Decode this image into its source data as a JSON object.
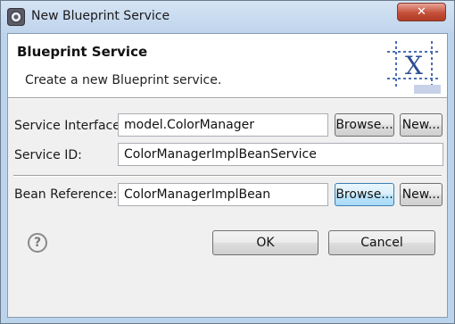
{
  "window": {
    "title": "New Blueprint Service",
    "close_glyph": "✕"
  },
  "header": {
    "title": "Blueprint Service",
    "description": "Create a new Blueprint service.",
    "banner_icon": "blueprint-x-icon"
  },
  "form": {
    "service_interface": {
      "label": "Service Interface:",
      "value": "model.ColorManager"
    },
    "service_id": {
      "label": "Service ID:",
      "value": "ColorManagerImplBeanService"
    },
    "bean_reference": {
      "label": "Bean Reference:",
      "value": "ColorManagerImplBean"
    },
    "browse_label": "Browse...",
    "new_label": "New..."
  },
  "footer": {
    "help_glyph": "?",
    "ok_label": "OK",
    "cancel_label": "Cancel"
  }
}
